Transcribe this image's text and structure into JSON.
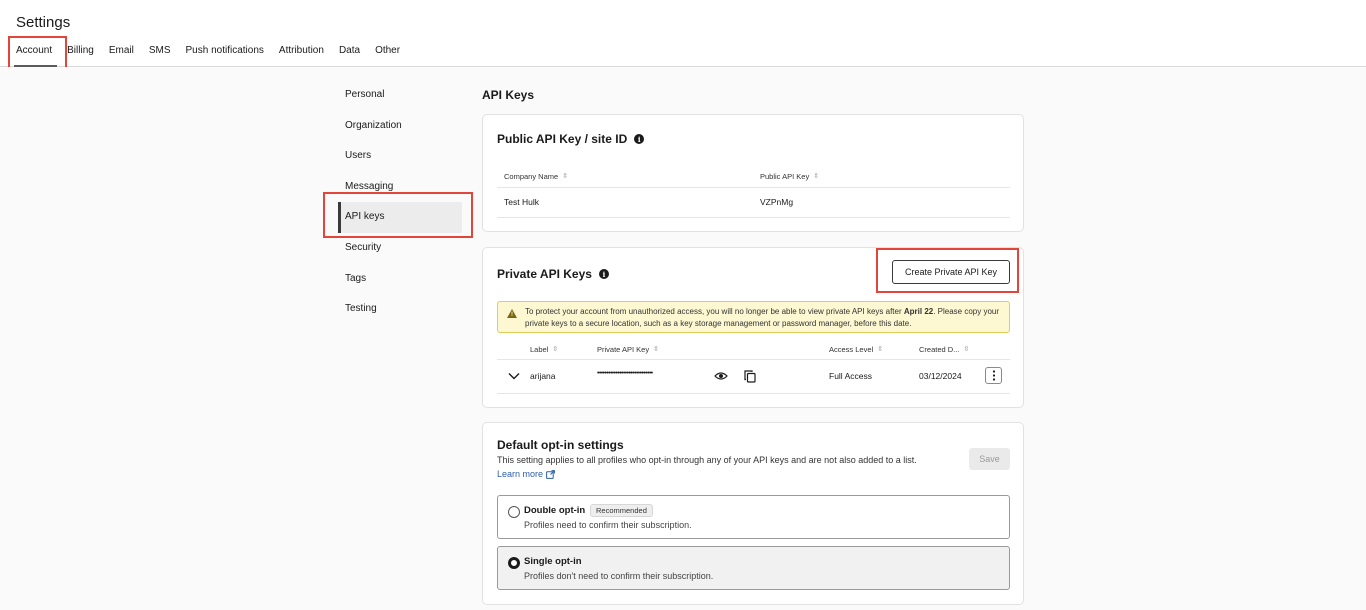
{
  "header": {
    "title": "Settings",
    "tabs": [
      {
        "label": "Account",
        "active": true
      },
      {
        "label": "Billing"
      },
      {
        "label": "Email"
      },
      {
        "label": "SMS"
      },
      {
        "label": "Push notifications"
      },
      {
        "label": "Attribution"
      },
      {
        "label": "Data"
      },
      {
        "label": "Other"
      }
    ]
  },
  "sidebar": {
    "items": [
      {
        "label": "Personal"
      },
      {
        "label": "Organization"
      },
      {
        "label": "Users"
      },
      {
        "label": "Messaging"
      },
      {
        "label": "API keys",
        "active": true
      },
      {
        "label": "Security"
      },
      {
        "label": "Tags"
      },
      {
        "label": "Testing"
      }
    ]
  },
  "main": {
    "section_title": "API Keys",
    "public_card": {
      "title": "Public API Key / site ID",
      "columns": [
        "Company Name",
        "Public API Key"
      ],
      "rows": [
        [
          "Test Hulk",
          "VZPnMg"
        ]
      ]
    },
    "private_card": {
      "title": "Private API Keys",
      "create_button": "Create Private API Key",
      "warning_pre": "To protect your account from unauthorized access, you will no longer be able to view private API keys after ",
      "warning_date": "April 22",
      "warning_post": ". Please copy your private keys to a secure location, such as a key storage management or password manager, before this date.",
      "columns": [
        "Label",
        "Private API Key",
        "Access Level",
        "Created D..."
      ],
      "rows": [
        {
          "label": "arijana",
          "key": "••••••••••••••••••••••••••••••",
          "access": "Full Access",
          "created": "03/12/2024"
        }
      ]
    },
    "optin_card": {
      "title": "Default opt-in settings",
      "description": "This setting applies to all profiles who opt-in through any of your API keys and are not also added to a list.",
      "learn_more": "Learn more",
      "save_label": "Save",
      "options": [
        {
          "label": "Double opt-in",
          "badge": "Recommended",
          "sub": "Profiles need to confirm their subscription.",
          "checked": false
        },
        {
          "label": "Single opt-in",
          "sub": "Profiles don't need to confirm their subscription.",
          "checked": true
        }
      ]
    }
  },
  "colors": {
    "highlight": "#e2463b",
    "link": "#2f5fa7",
    "warning_bg": "#fdf8d2"
  }
}
